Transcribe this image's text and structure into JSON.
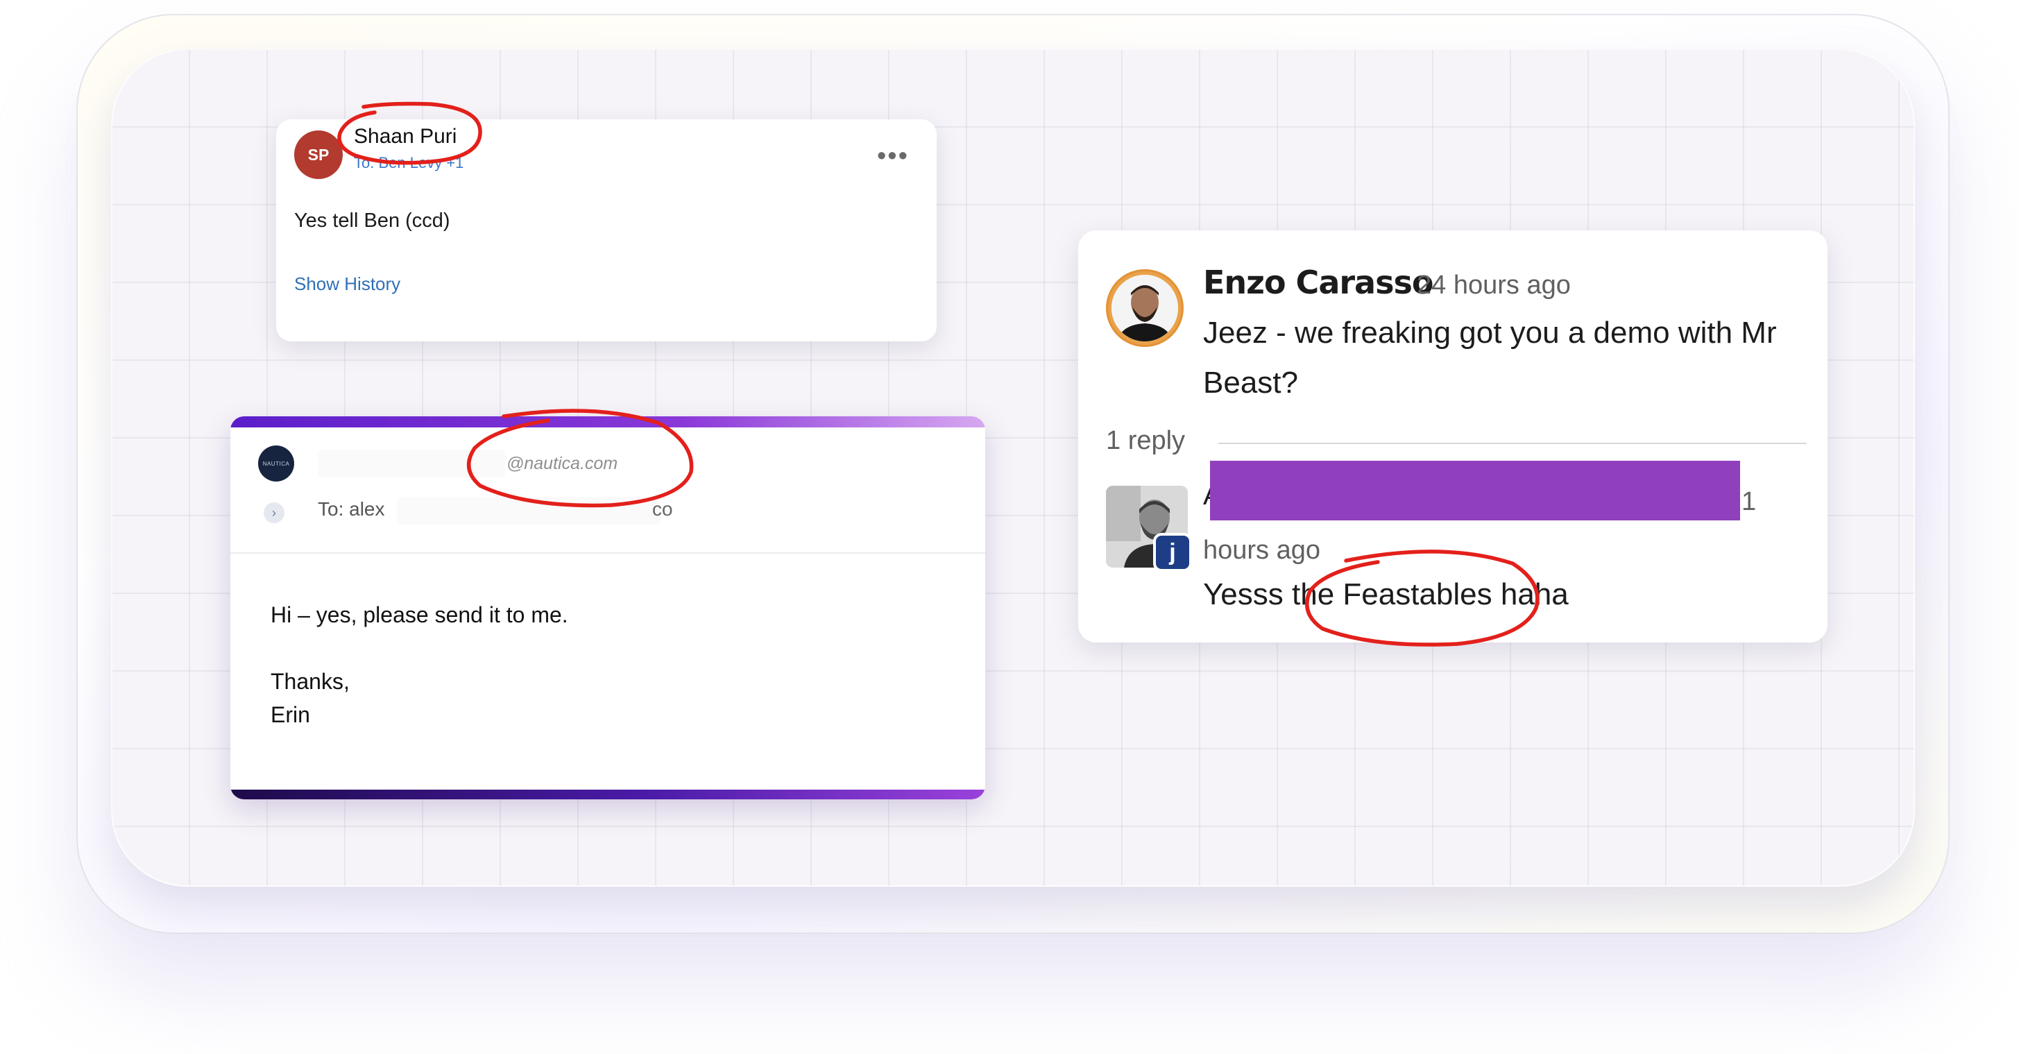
{
  "email_card": {
    "avatar_initials": "SP",
    "sender_name": "Shaan Puri",
    "recipients": "To: Ben Levy +1",
    "more_icon": "more-horizontal-icon",
    "body": "Yes tell Ben (ccd)",
    "show_history": "Show History"
  },
  "reply_card": {
    "logo_text": "NAUTICA",
    "from_domain": "@nautica.com",
    "to_label": "To: alex",
    "to_suffix": "co",
    "body_lines": [
      "Hi – yes, please send it to me.",
      "",
      "Thanks,",
      "Erin"
    ]
  },
  "slack_card": {
    "author": "Enzo Carasso",
    "timestamp": "24 hours ago",
    "message": "Jeez - we freaking got you a demo with Mr Beast?",
    "reply_count": "1 reply",
    "reply_author_initial": "A",
    "reply_time_prefix": "1",
    "reply_time": "hours ago",
    "reply_message": "Yesss the Feastables haha",
    "badge_letter": "j"
  },
  "colors": {
    "annotation_red": "#e3201b",
    "redaction_purple": "#9040bd",
    "sp_avatar": "#b23a2f",
    "link_blue": "#2f6fb8"
  }
}
